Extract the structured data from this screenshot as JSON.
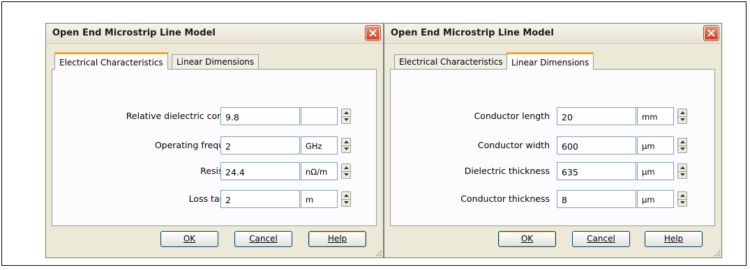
{
  "left_dialog": {
    "title": "Open End Microstrip Line Model",
    "tabs": [
      "Electrical Characteristics",
      "Linear Dimensions"
    ],
    "active_tab": "Electrical Characteristics",
    "rows": [
      {
        "label": "Relative dielectric constant",
        "value": "9.8",
        "unit": ""
      },
      {
        "label": "Operating frequency",
        "value": "2",
        "unit": "GHz"
      },
      {
        "label": "Resistivity",
        "value": "24.4",
        "unit": "nΩ/m"
      },
      {
        "label": "Loss tangent",
        "value": "2",
        "unit": "m"
      }
    ],
    "buttons": {
      "ok": "OK",
      "cancel": "Cancel",
      "help": "Help"
    }
  },
  "right_dialog": {
    "title": "Open End Microstrip Line Model",
    "tabs": [
      "Electrical Characteristics",
      "Linear Dimensions"
    ],
    "active_tab": "Linear Dimensions",
    "rows": [
      {
        "label": "Conductor length",
        "value": "20",
        "unit": "mm"
      },
      {
        "label": "Conductor width",
        "value": "600",
        "unit": "μm"
      },
      {
        "label": "Dielectric thickness",
        "value": "635",
        "unit": "μm"
      },
      {
        "label": "Conductor thickness",
        "value": "8",
        "unit": "μm"
      }
    ],
    "buttons": {
      "ok": "OK",
      "cancel": "Cancel",
      "help": "Help"
    }
  },
  "icons": {
    "close": "close-icon",
    "spin_up": "arrow-up-icon",
    "spin_down": "arrow-down-icon",
    "grip": "resize-grip-icon"
  },
  "colors": {
    "close_button": "#d4502c",
    "active_tab_accent": "#e9a92b",
    "input_border": "#7f9db9",
    "dialog_bg": "#ece9d8"
  }
}
